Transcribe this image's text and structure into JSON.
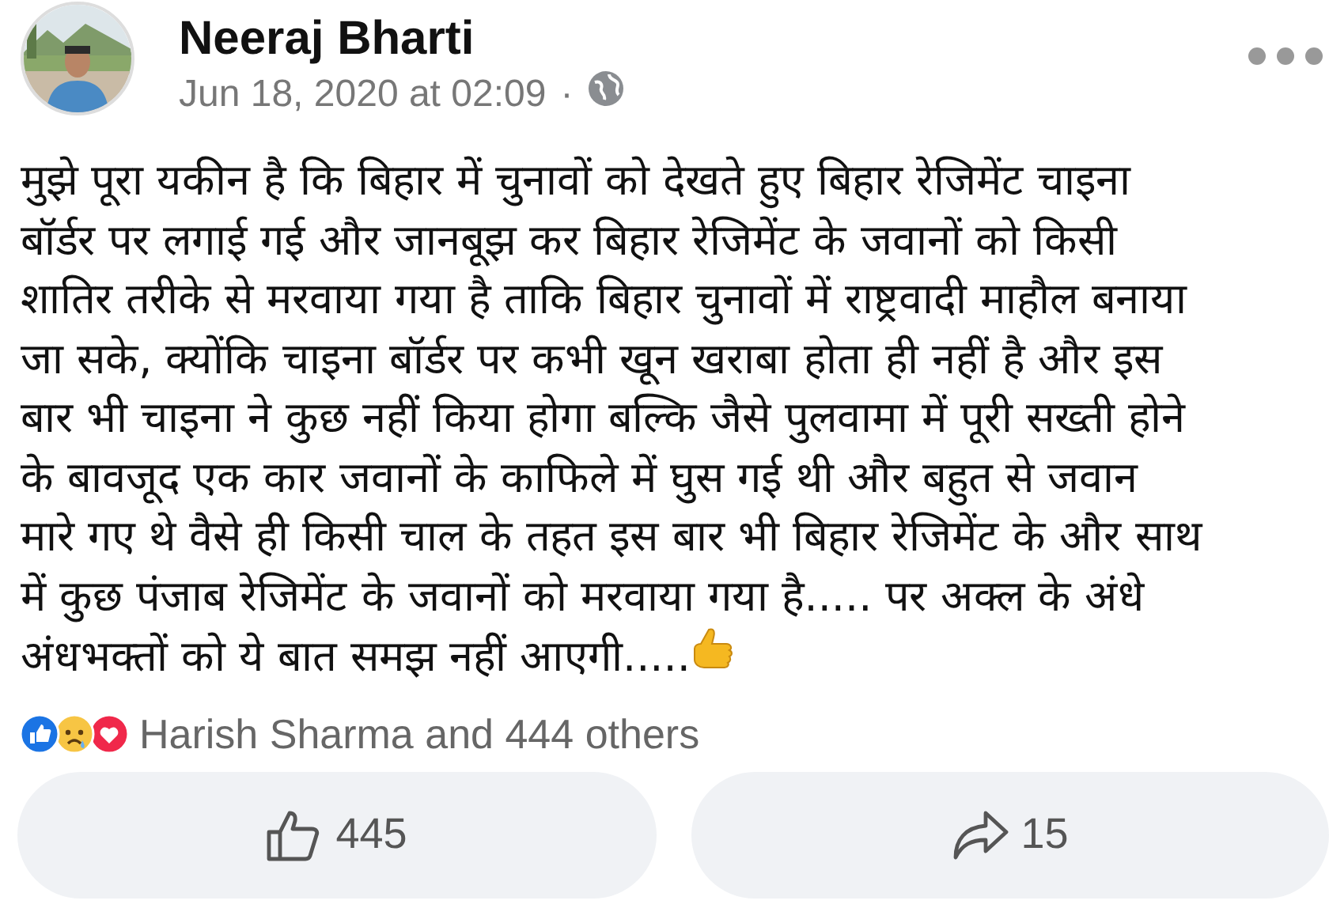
{
  "post": {
    "author": "Neeraj Bharti",
    "timestamp": "Jun 18, 2020 at 02:09",
    "separator": "·",
    "public": true,
    "body": "मुझे पूरा यकीन है कि बिहार में चुनावों को देखते हुए बिहार रेजिमेंट चाइना\nबॉर्डर पर लगाई गई और जानबूझ कर बिहार रेजिमेंट के जवानों को किसी\nशातिर तरीके से मरवाया गया है ताकि बिहार चुनावों में राष्ट्रवादी माहौल बनाया\nजा सके, क्योंकि चाइना बॉर्डर पर कभी खून खराबा होता ही नहीं है और इस\nबार भी चाइना ने कुछ नहीं किया होगा बल्कि जैसे पुलवामा में पूरी सख्ती होने\nके बावजूद एक कार जवानों के काफिले में घुस गई थी और बहुत से जवान\nमारे गए थे वैसे ही किसी चाल के तहत इस बार भी बिहार रेजिमेंट के और साथ\nमें कुछ पंजाब रेजिमेंट के जवानों को मरवाया गया है..... पर अक्ल के अंधे\nअंधभक्तों को ये बात समझ नहीं आएगी.....",
    "reactions": [
      {
        "kind": "like"
      },
      {
        "kind": "sad"
      },
      {
        "kind": "love"
      }
    ],
    "reaction_summary": "Harish Sharma and 444 others",
    "actions": [
      {
        "kind": "like",
        "label": "445"
      },
      {
        "kind": "share",
        "label": "15"
      }
    ]
  }
}
